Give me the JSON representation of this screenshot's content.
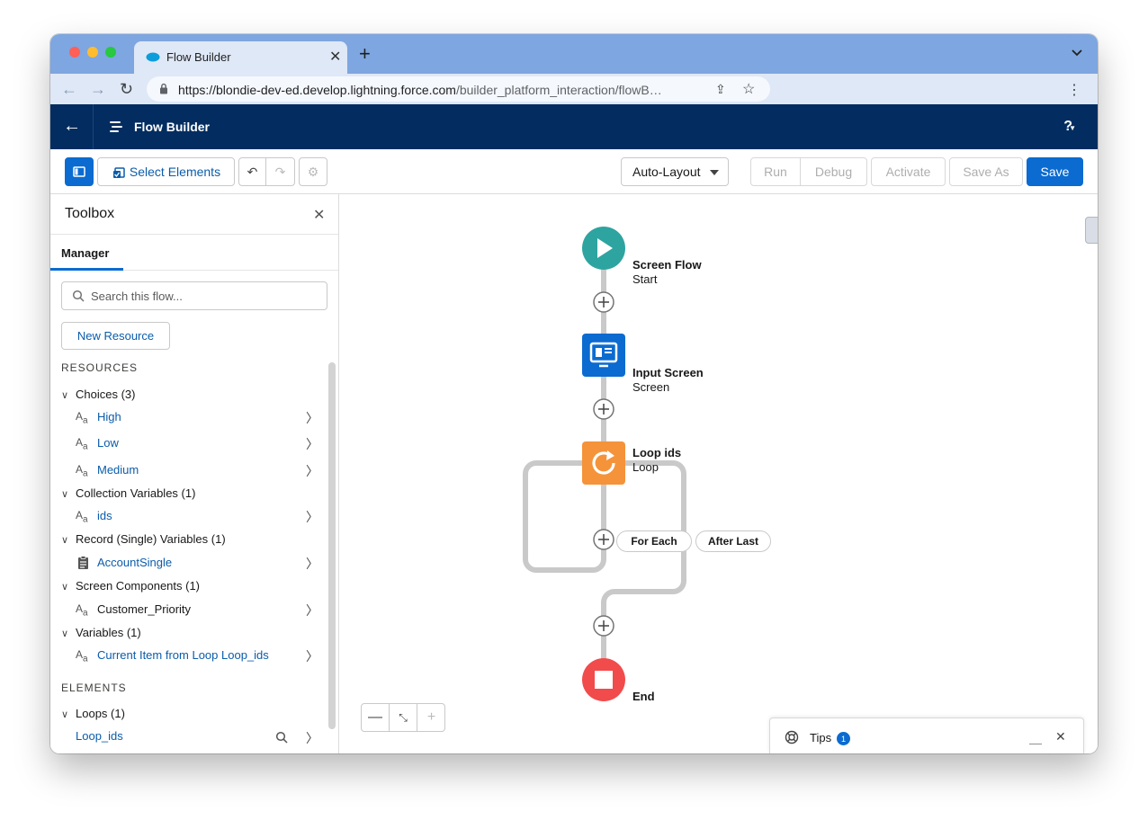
{
  "browser": {
    "tab_title": "Flow Builder",
    "tab_close": "✕",
    "new_tab": "+",
    "url_host": "https://blondie-dev-ed.develop.lightning.force.com",
    "url_path": "/builder_platform_interaction/flowB…"
  },
  "app": {
    "title": "Flow Builder",
    "help": "?"
  },
  "toolbar": {
    "select_elements": "Select Elements",
    "layout": "Auto-Layout",
    "run": "Run",
    "debug": "Debug",
    "activate": "Activate",
    "save_as": "Save As",
    "save": "Save"
  },
  "toolbox": {
    "title": "Toolbox",
    "tab": "Manager",
    "search_placeholder": "Search this flow...",
    "new_resource": "New Resource",
    "resources_heading": "RESOURCES",
    "elements_heading": "ELEMENTS",
    "groups": [
      {
        "label": "Choices (3)",
        "items": [
          "High",
          "Low",
          "Medium"
        ]
      },
      {
        "label": "Collection Variables (1)",
        "items": [
          "ids"
        ]
      },
      {
        "label": "Record (Single) Variables (1)",
        "items": [
          "AccountSingle"
        ]
      },
      {
        "label": "Screen Components (1)",
        "items": [
          "Customer_Priority"
        ]
      },
      {
        "label": "Variables (1)",
        "items": [
          "Current Item from Loop Loop_ids"
        ]
      }
    ],
    "element_groups": [
      {
        "label": "Loops (1)",
        "items": [
          "Loop_ids"
        ]
      }
    ]
  },
  "flow": {
    "start": {
      "title": "Screen Flow",
      "subtitle": "Start",
      "color": "#2ea4a0"
    },
    "screen": {
      "title": "Input Screen",
      "subtitle": "Screen",
      "color": "#0b6bd0"
    },
    "loop": {
      "title": "Loop ids",
      "subtitle": "Loop",
      "color": "#f5933a"
    },
    "end": {
      "title": "End",
      "color": "#f24b4b"
    },
    "for_each": "For Each",
    "after_last": "After Last"
  },
  "tips": {
    "label": "Tips",
    "count": "1"
  },
  "colors": {
    "header_bg": "#032d60",
    "brand_blue": "#0b6bd0",
    "connector": "#c9c9c9"
  }
}
